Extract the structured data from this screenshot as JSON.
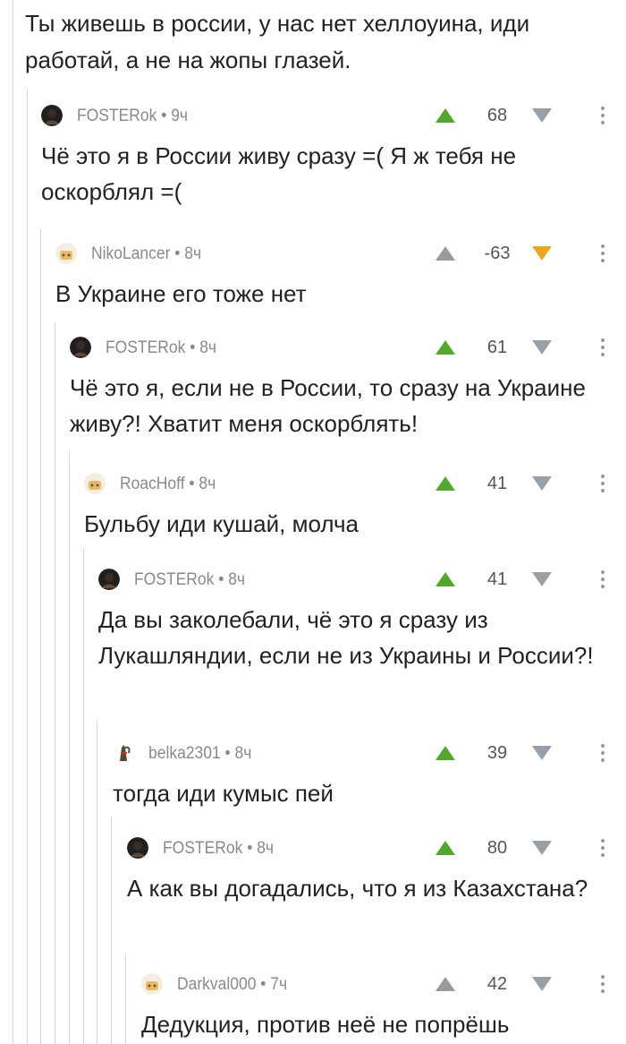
{
  "parent_comment": {
    "text": "Ты живешь в россии, у нас нет хеллоуина, иди работай, а не на жопы глазей."
  },
  "colors": {
    "upvote": "#55a630",
    "upvote_inactive": "#9a9a9a",
    "downvote": "#9aa0a6",
    "downvote_active": "#e8a825",
    "thread_line": "#d8d8d8",
    "meta_text": "#8a8a8a"
  },
  "comments": [
    {
      "author": "FOSTERok",
      "time": "9ч",
      "rating": "68",
      "avatar": "dark-avatar",
      "vote": "up",
      "text": "Чё это я в России живу сразу =( Я ж тебя не оскорблял =("
    },
    {
      "author": "NikoLancer",
      "time": "8ч",
      "rating": "-63",
      "avatar": "default-avatar",
      "vote": "down",
      "text": "В Украине его тоже нет"
    },
    {
      "author": "FOSTERok",
      "time": "8ч",
      "rating": "61",
      "avatar": "dark-avatar",
      "vote": "up",
      "text": "Чё это я, если не в России, то сразу на Украине живу?! Хватит меня оскорблять!"
    },
    {
      "author": "RoacHoff",
      "time": "8ч",
      "rating": "41",
      "avatar": "default-avatar",
      "vote": "up",
      "text": "Бульбу иди кушай, молча"
    },
    {
      "author": "FOSTERok",
      "time": "8ч",
      "rating": "41",
      "avatar": "dark-avatar",
      "vote": "up",
      "text": "Да вы заколебали, чё это я сразу из Лукашляндии, если не из Украины и России?!"
    },
    {
      "author": "belka2301",
      "time": "8ч",
      "rating": "39",
      "avatar": "squirrel-avatar",
      "vote": "up",
      "text": "тогда иди кумыс пей"
    },
    {
      "author": "FOSTERok",
      "time": "8ч",
      "rating": "80",
      "avatar": "dark-avatar",
      "vote": "up",
      "text": "А как вы догадались, что я из Казахстана?"
    },
    {
      "author": "Darkval000",
      "time": "7ч",
      "rating": "42",
      "avatar": "default-avatar",
      "vote": "none",
      "text": "Дедукция, против неё не попрёшь"
    }
  ]
}
